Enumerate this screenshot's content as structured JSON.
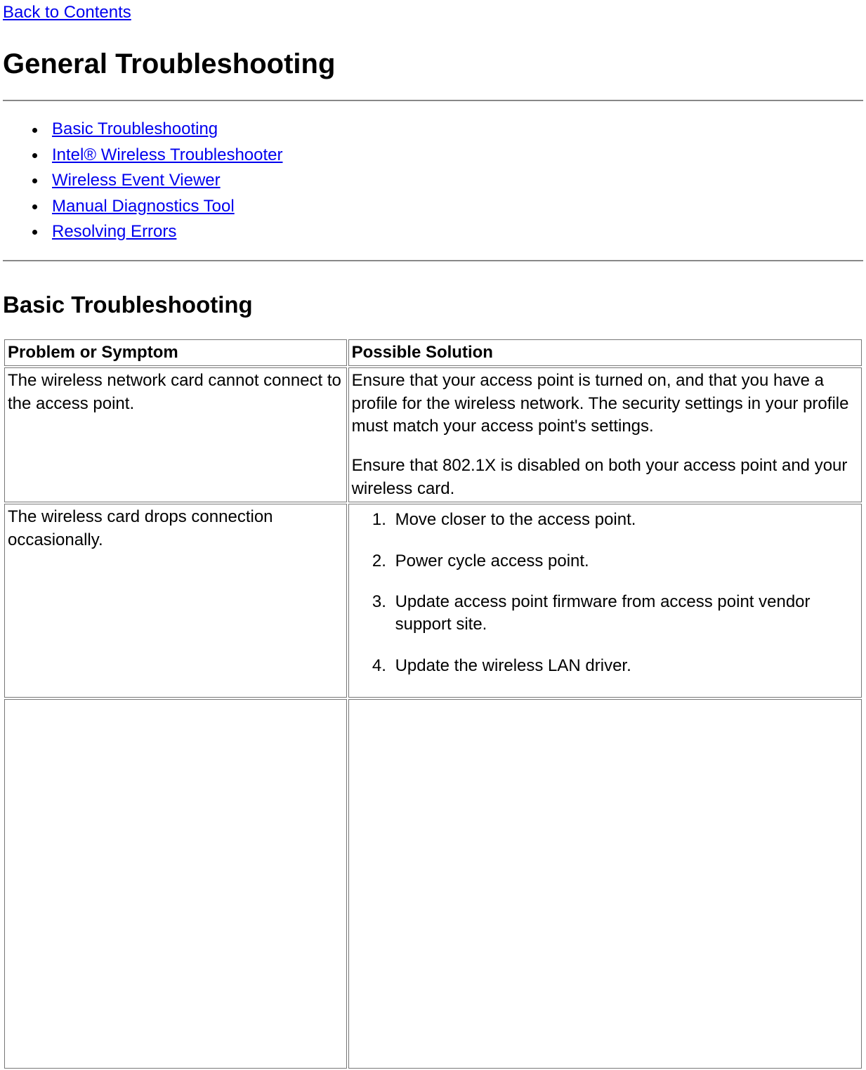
{
  "nav": {
    "back_link": "Back to Contents"
  },
  "headings": {
    "main": "General Troubleshooting",
    "section1": "Basic Troubleshooting"
  },
  "toc": [
    "Basic Troubleshooting",
    "Intel® Wireless Troubleshooter",
    "Wireless Event Viewer",
    "Manual Diagnostics Tool",
    "Resolving Errors"
  ],
  "table": {
    "headers": {
      "problem": "Problem or Symptom",
      "solution": "Possible Solution"
    },
    "rows": [
      {
        "problem": "The wireless network card cannot connect to the access point.",
        "solution_paras": [
          "Ensure that your access point is turned on, and that you have a profile for the wireless network. The security settings in your profile must match your access point's settings.",
          "Ensure that 802.1X is disabled on both your access point and your wireless card."
        ]
      },
      {
        "problem": "The wireless card drops connection occasionally.",
        "solution_steps": [
          "Move closer to the access point.",
          "Power cycle access point.",
          "Update access point firmware from access point vendor support site.",
          "Update the wireless LAN driver."
        ]
      }
    ]
  }
}
